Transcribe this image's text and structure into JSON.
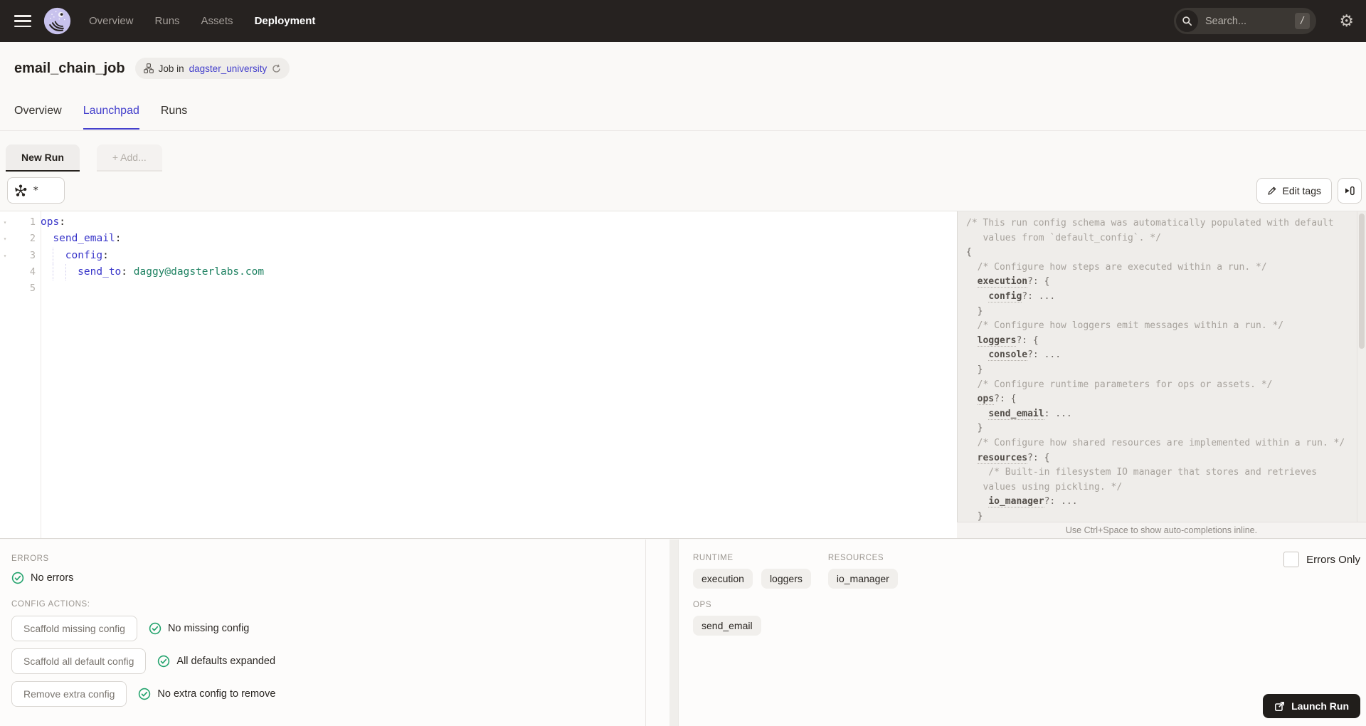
{
  "topbar": {
    "nav_items": [
      {
        "label": "Overview",
        "active": false
      },
      {
        "label": "Runs",
        "active": false
      },
      {
        "label": "Assets",
        "active": false
      },
      {
        "label": "Deployment",
        "active": true
      }
    ],
    "search": {
      "placeholder": "Search...",
      "shortcut": "/"
    }
  },
  "header": {
    "title": "email_chain_job",
    "badge_prefix": "Job in",
    "badge_link": "dagster_university"
  },
  "page_tabs": [
    {
      "label": "Overview",
      "active": false
    },
    {
      "label": "Launchpad",
      "active": true
    },
    {
      "label": "Runs",
      "active": false
    }
  ],
  "run_tabs": {
    "active_tab": "New Run",
    "add_tab": "+ Add..."
  },
  "toolbar": {
    "op_selector_value": "*",
    "edit_tags_label": "Edit tags"
  },
  "editor": {
    "lines": [
      {
        "num": "1",
        "indent": 0,
        "fold": true,
        "segments": [
          {
            "text": "ops",
            "style": "key"
          },
          {
            "text": ":",
            "style": "plain"
          }
        ]
      },
      {
        "num": "2",
        "indent": 1,
        "fold": true,
        "segments": [
          {
            "text": "send_email",
            "style": "key"
          },
          {
            "text": ":",
            "style": "plain"
          }
        ]
      },
      {
        "num": "3",
        "indent": 2,
        "fold": true,
        "segments": [
          {
            "text": "config",
            "style": "key"
          },
          {
            "text": ":",
            "style": "plain"
          }
        ]
      },
      {
        "num": "4",
        "indent": 3,
        "fold": false,
        "segments": [
          {
            "text": "send_to",
            "style": "key"
          },
          {
            "text": ": ",
            "style": "plain"
          },
          {
            "text": "daggy@dagsterlabs.com",
            "style": "value"
          }
        ]
      },
      {
        "num": "5",
        "indent": 0,
        "fold": false,
        "segments": []
      }
    ]
  },
  "schema_panel": {
    "lines": [
      [
        {
          "text": "/* This run config schema was automatically populated with default",
          "style": "comment"
        }
      ],
      [
        {
          "text": "   values from `default_config`. */",
          "style": "comment"
        }
      ],
      [
        {
          "text": "{",
          "style": "plain"
        }
      ],
      [
        {
          "text": "  /* Configure how steps are executed within a run. */",
          "style": "comment"
        }
      ],
      [
        {
          "text": "  ",
          "style": "plain"
        },
        {
          "text": "execution",
          "style": "key"
        },
        {
          "text": "?: {",
          "style": "plain"
        }
      ],
      [
        {
          "text": "    ",
          "style": "plain"
        },
        {
          "text": "config",
          "style": "key"
        },
        {
          "text": "?: ...",
          "style": "plain"
        }
      ],
      [
        {
          "text": "  }",
          "style": "plain"
        }
      ],
      [
        {
          "text": "  /* Configure how loggers emit messages within a run. */",
          "style": "comment"
        }
      ],
      [
        {
          "text": "  ",
          "style": "plain"
        },
        {
          "text": "loggers",
          "style": "key"
        },
        {
          "text": "?: {",
          "style": "plain"
        }
      ],
      [
        {
          "text": "    ",
          "style": "plain"
        },
        {
          "text": "console",
          "style": "key"
        },
        {
          "text": "?: ...",
          "style": "plain"
        }
      ],
      [
        {
          "text": "  }",
          "style": "plain"
        }
      ],
      [
        {
          "text": "  /* Configure runtime parameters for ops or assets. */",
          "style": "comment"
        }
      ],
      [
        {
          "text": "  ",
          "style": "plain"
        },
        {
          "text": "ops",
          "style": "key"
        },
        {
          "text": "?: {",
          "style": "plain"
        }
      ],
      [
        {
          "text": "    ",
          "style": "plain"
        },
        {
          "text": "send_email",
          "style": "key"
        },
        {
          "text": ": ...",
          "style": "plain"
        }
      ],
      [
        {
          "text": "  }",
          "style": "plain"
        }
      ],
      [
        {
          "text": "  /* Configure how shared resources are implemented within a run. */",
          "style": "comment"
        }
      ],
      [
        {
          "text": "  ",
          "style": "plain"
        },
        {
          "text": "resources",
          "style": "key"
        },
        {
          "text": "?: {",
          "style": "plain"
        }
      ],
      [
        {
          "text": "    /* Built-in filesystem IO manager that stores and retrieves",
          "style": "comment"
        }
      ],
      [
        {
          "text": "   values using pickling. */",
          "style": "comment"
        }
      ],
      [
        {
          "text": "    ",
          "style": "plain"
        },
        {
          "text": "io_manager",
          "style": "key"
        },
        {
          "text": "?: ...",
          "style": "plain"
        }
      ],
      [
        {
          "text": "  }",
          "style": "plain"
        }
      ]
    ],
    "hint": "Use Ctrl+Space to show auto-completions inline."
  },
  "bottom_panel": {
    "errors_section": {
      "label": "ERRORS",
      "status": "No errors"
    },
    "config_actions": {
      "label": "CONFIG ACTIONS:",
      "rows": [
        {
          "button": "Scaffold missing config",
          "status": "No missing config"
        },
        {
          "button": "Scaffold all default config",
          "status": "All defaults expanded"
        },
        {
          "button": "Remove extra config",
          "status": "No extra config to remove"
        }
      ]
    },
    "groups": [
      {
        "label": "RUNTIME",
        "chips": [
          "execution",
          "loggers"
        ]
      },
      {
        "label": "RESOURCES",
        "chips": [
          "io_manager"
        ]
      },
      {
        "label": "OPS",
        "chips": [
          "send_email"
        ]
      }
    ],
    "errors_only_label": "Errors Only",
    "launch_button_label": "Launch Run"
  },
  "colors": {
    "topbar": "#262220",
    "accent": "#4440CC",
    "code_key": "#3734C9",
    "code_value": "#1F8262",
    "success_green": "#23A36D"
  }
}
